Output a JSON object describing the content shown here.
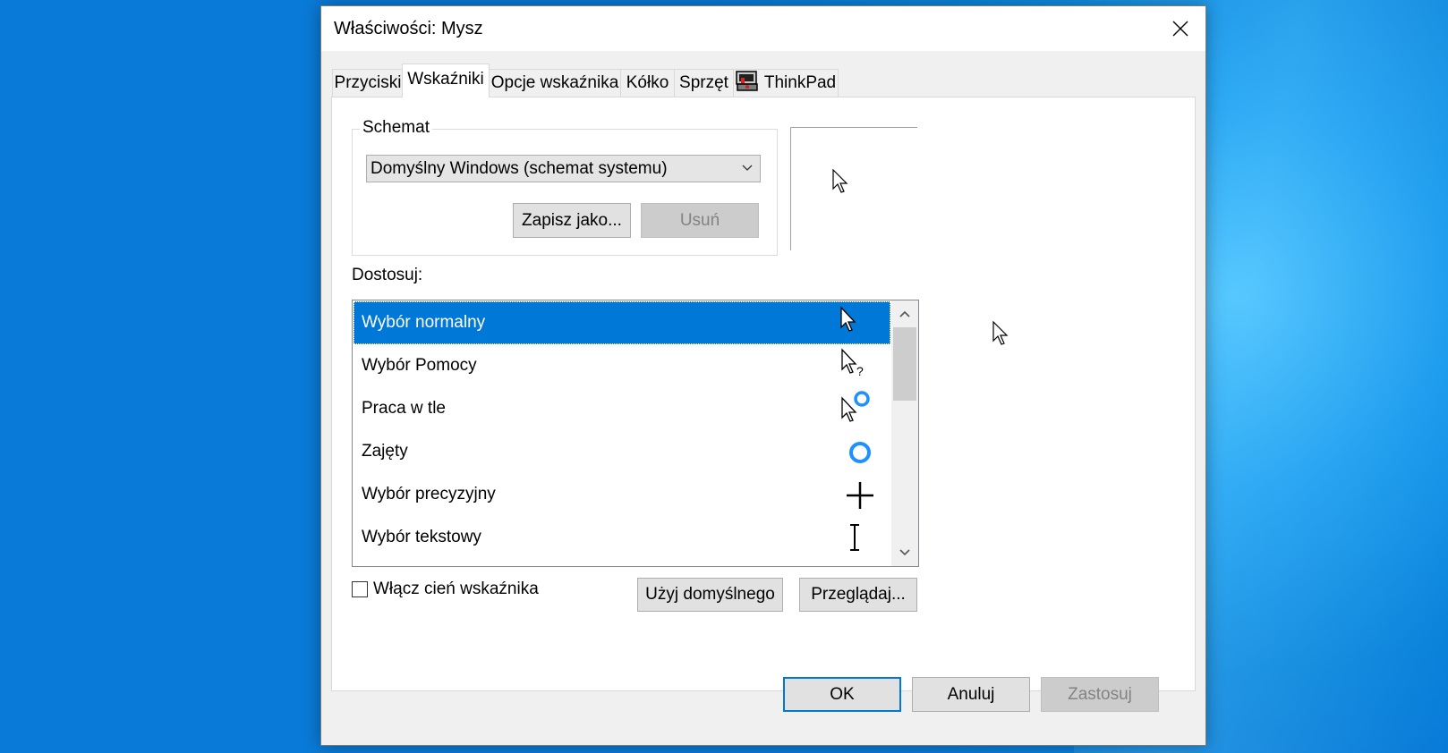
{
  "dialog": {
    "title": "Właściwości: Mysz",
    "close_icon": "close-icon"
  },
  "tabs": [
    {
      "label": "Przyciski"
    },
    {
      "label": "Wskaźniki"
    },
    {
      "label": "Opcje wskaźnika"
    },
    {
      "label": "Kółko"
    },
    {
      "label": "Sprzęt"
    },
    {
      "label": "ThinkPad",
      "icon": "thinkpad-icon"
    }
  ],
  "scheme": {
    "legend": "Schemat",
    "selected": "Domyślny Windows (schemat systemu)",
    "save_as": "Zapisz jako...",
    "delete": "Usuń"
  },
  "customize": {
    "label": "Dostosuj:",
    "items": [
      {
        "label": "Wybór normalny",
        "icon": "arrow-cursor-icon"
      },
      {
        "label": "Wybór Pomocy",
        "icon": "help-cursor-icon"
      },
      {
        "label": "Praca w tle",
        "icon": "working-background-cursor-icon"
      },
      {
        "label": "Zajęty",
        "icon": "busy-cursor-icon"
      },
      {
        "label": "Wybór precyzyjny",
        "icon": "crosshair-cursor-icon"
      },
      {
        "label": "Wybór tekstowy",
        "icon": "text-beam-cursor-icon"
      }
    ]
  },
  "shadow": {
    "label": "Włącz cień wskaźnika",
    "checked": false
  },
  "buttons": {
    "use_default": "Użyj domyślnego",
    "browse": "Przeglądaj...",
    "ok": "OK",
    "cancel": "Anuluj",
    "apply": "Zastosuj"
  },
  "colors": {
    "accent": "#0078d7",
    "desktop": "#0a86dc"
  }
}
